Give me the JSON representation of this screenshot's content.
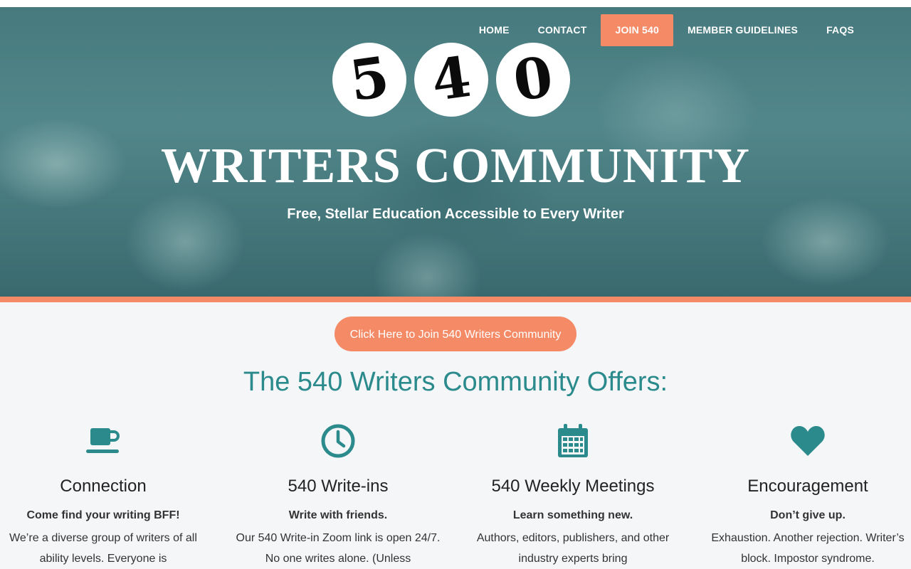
{
  "nav": {
    "items": [
      "HOME",
      "CONTACT",
      "JOIN 540",
      "MEMBER GUIDELINES",
      "FAQS"
    ]
  },
  "logo": {
    "digits": [
      "5",
      "4",
      "0"
    ]
  },
  "hero": {
    "title": "WRITERS COMMUNITY",
    "subtitle": "Free, Stellar Education Accessible to Every Writer"
  },
  "cta": {
    "label": "Click Here to Join 540 Writers Community"
  },
  "offers": {
    "title": "The 540 Writers Community Offers:",
    "features": [
      {
        "icon": "coffee-cup-icon",
        "title": "Connection",
        "lead": "Come find your writing BFF!",
        "body": "We’re a diverse group of writers of all ability levels. Everyone is"
      },
      {
        "icon": "clock-icon",
        "title": "540 Write-ins",
        "lead": "Write with friends.",
        "body": "Our 540 Write-in Zoom link is open 24/7. No one writes alone. (Unless"
      },
      {
        "icon": "calendar-icon",
        "title": "540 Weekly Meetings",
        "lead": "Learn something new.",
        "body": "Authors, editors, publishers, and other industry experts bring"
      },
      {
        "icon": "heart-icon",
        "title": "Encouragement",
        "lead": "Don’t give up.",
        "body": "Exhaustion. Another rejection. Writer’s block. Impostor syndrome."
      }
    ]
  },
  "colors": {
    "accent": "#f58a66",
    "teal": "#2b8a8c",
    "hero_tint": "#4f8487"
  }
}
